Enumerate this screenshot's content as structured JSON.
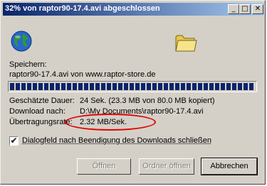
{
  "window": {
    "title": "32% von raptor90-17.4.avi abgeschlossen",
    "minimize_glyph": "_",
    "maximize_glyph": "□",
    "close_glyph": "✕"
  },
  "icons": {
    "globe": "globe-icon",
    "folder": "folder-icon"
  },
  "download": {
    "saving_label": "Speichern:",
    "file_info": "raptor90-17.4.avi von www.raptor-store.de",
    "progress_fraction": 1.0,
    "estimated_label": "Geschätzte Dauer:",
    "estimated_value": "24 Sek. (23.3 MB von 80.0 MB kopiert)",
    "target_label": "Download nach:",
    "target_value": "D:\\My Documents\\raptor90-17.4.avi",
    "rate_label": "Übertragungsrate:",
    "rate_value": "2.32 MB/Sek."
  },
  "options": {
    "close_dialog_label": "Dialogfeld nach Beendigung des Downloads schließen",
    "close_dialog_checked": true,
    "check_glyph": "✔"
  },
  "buttons": {
    "open": "Öffnen",
    "open_folder": "Ordner öffnen",
    "cancel": "Abbrechen"
  },
  "colors": {
    "titlebar_start": "#0a246a",
    "titlebar_end": "#a6caf0",
    "highlight_ellipse": "#e00000"
  }
}
